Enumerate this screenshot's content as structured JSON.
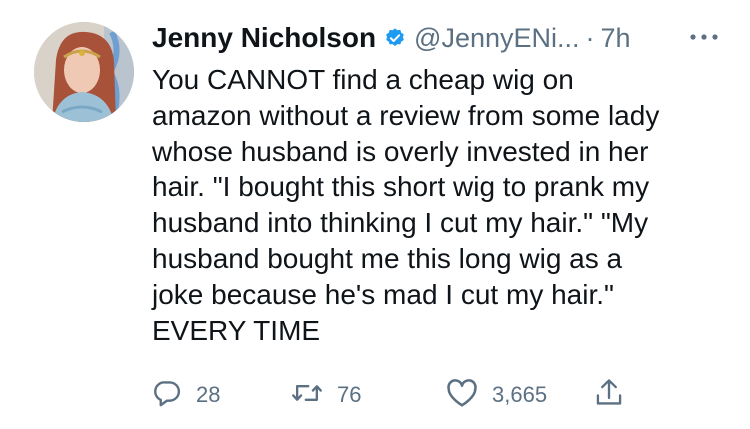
{
  "tweet": {
    "author_name": "Jenny Nicholson",
    "handle": "@JennyENi...",
    "separator": "·",
    "time": "7h",
    "verified": true,
    "text": "You CANNOT find a cheap wig on\namazon without a review from some lady\nwhose husband is overly invested in her\nhair. \"I bought this short wig to prank my\nhusband into thinking I cut my hair.\" \"My\nhusband bought me this long wig as a\njoke because he's mad I cut my hair.\"\nEVERY TIME"
  },
  "actions": {
    "reply_count": "28",
    "retweet_count": "76",
    "like_count": "3,665"
  },
  "icons": {
    "verified": "verified-badge-icon",
    "more": "more-options-icon",
    "reply": "reply-icon",
    "retweet": "retweet-icon",
    "like": "heart-icon",
    "share": "share-icon"
  },
  "colors": {
    "text": "#0f1419",
    "secondary": "#5b7083",
    "verified": "#1d9bf0"
  }
}
